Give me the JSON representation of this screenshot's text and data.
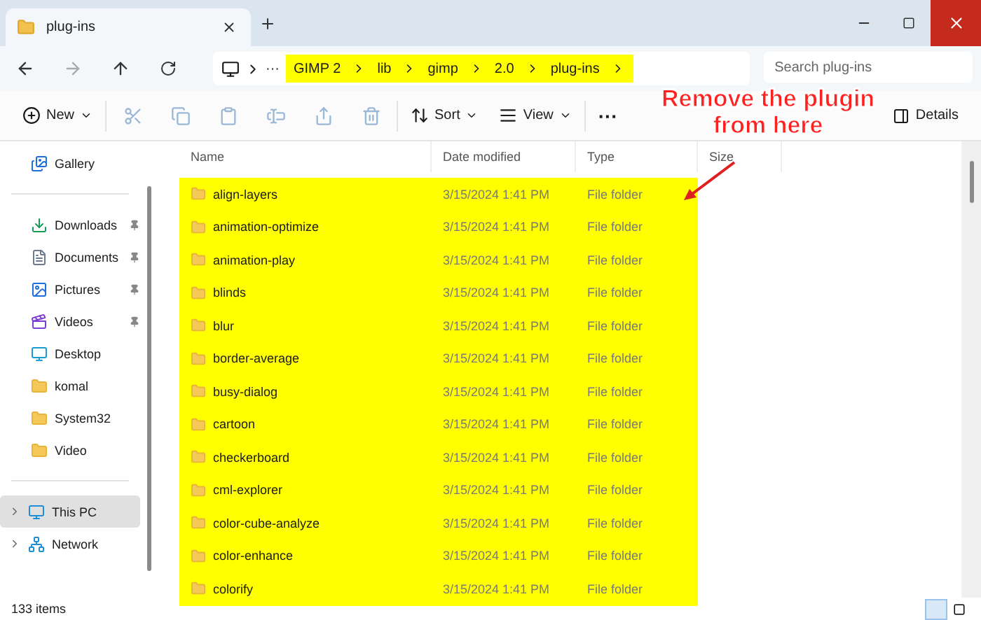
{
  "tab": {
    "title": "plug-ins"
  },
  "address": {
    "crumbs": [
      "GIMP 2",
      "lib",
      "gimp",
      "2.0",
      "plug-ins"
    ],
    "highlighted": true,
    "overflow": "···"
  },
  "search": {
    "placeholder": "Search plug-ins"
  },
  "toolbar": [
    {
      "kind": "menu",
      "label": "New",
      "disabled": false
    },
    {
      "kind": "icon",
      "disabled": true
    },
    {
      "kind": "icon",
      "disabled": true
    },
    {
      "kind": "icon",
      "disabled": true
    },
    {
      "kind": "icon",
      "disabled": true
    },
    {
      "kind": "icon",
      "disabled": true
    },
    {
      "kind": "icon",
      "disabled": true
    },
    {
      "kind": "menu",
      "label": "Sort",
      "disabled": false
    },
    {
      "kind": "menu",
      "label": "View",
      "disabled": false
    },
    {
      "kind": "more",
      "label": "···",
      "disabled": false
    }
  ],
  "details_button": {
    "label": "Details"
  },
  "sidebar": {
    "top": [
      {
        "label": "Gallery"
      }
    ],
    "quick": [
      {
        "label": "Downloads",
        "pinned": true
      },
      {
        "label": "Documents",
        "pinned": true
      },
      {
        "label": "Pictures",
        "pinned": true
      },
      {
        "label": "Videos",
        "pinned": true
      },
      {
        "label": "Desktop",
        "pinned": false
      },
      {
        "label": "komal",
        "pinned": false
      },
      {
        "label": "System32",
        "pinned": false
      },
      {
        "label": "Video",
        "pinned": false
      }
    ],
    "roots": [
      {
        "label": "This PC",
        "selected": true,
        "expanded": false
      },
      {
        "label": "Network",
        "selected": false,
        "expanded": false
      }
    ]
  },
  "columns": [
    "Name",
    "Date modified",
    "Type",
    "Size"
  ],
  "rows_highlighted": true,
  "rows": [
    {
      "name": "align-layers",
      "date": "3/15/2024 1:41 PM",
      "type": "File folder"
    },
    {
      "name": "animation-optimize",
      "date": "3/15/2024 1:41 PM",
      "type": "File folder"
    },
    {
      "name": "animation-play",
      "date": "3/15/2024 1:41 PM",
      "type": "File folder"
    },
    {
      "name": "blinds",
      "date": "3/15/2024 1:41 PM",
      "type": "File folder"
    },
    {
      "name": "blur",
      "date": "3/15/2024 1:41 PM",
      "type": "File folder"
    },
    {
      "name": "border-average",
      "date": "3/15/2024 1:41 PM",
      "type": "File folder"
    },
    {
      "name": "busy-dialog",
      "date": "3/15/2024 1:41 PM",
      "type": "File folder"
    },
    {
      "name": "cartoon",
      "date": "3/15/2024 1:41 PM",
      "type": "File folder"
    },
    {
      "name": "checkerboard",
      "date": "3/15/2024 1:41 PM",
      "type": "File folder"
    },
    {
      "name": "cml-explorer",
      "date": "3/15/2024 1:41 PM",
      "type": "File folder"
    },
    {
      "name": "color-cube-analyze",
      "date": "3/15/2024 1:41 PM",
      "type": "File folder"
    },
    {
      "name": "color-enhance",
      "date": "3/15/2024 1:41 PM",
      "type": "File folder"
    },
    {
      "name": "colorify",
      "date": "3/15/2024 1:41 PM",
      "type": "File folder"
    }
  ],
  "status": {
    "count": "133 items"
  },
  "view_modes": [
    {
      "selected": true
    },
    {
      "selected": false
    }
  ],
  "annotation": {
    "lines": [
      "Remove the plugin",
      "from here"
    ]
  }
}
